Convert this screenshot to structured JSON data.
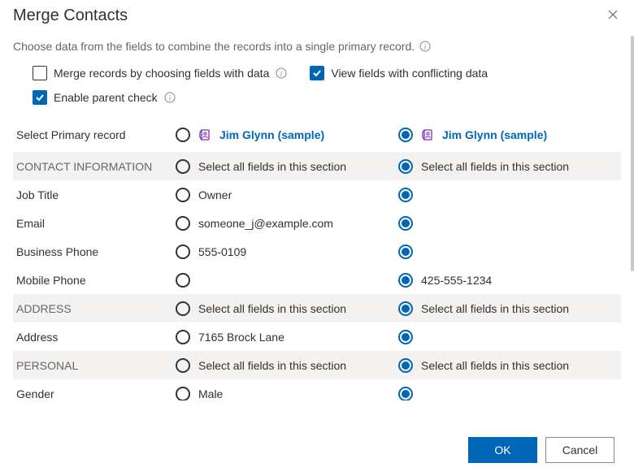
{
  "title": "Merge Contacts",
  "description": "Choose data from the fields to combine the records into a single primary record.",
  "options": {
    "merge_by_fields": {
      "label": "Merge records by choosing fields with data",
      "checked": false
    },
    "conflicting": {
      "label": "View fields with conflicting data",
      "checked": true
    },
    "parent_check": {
      "label": "Enable parent check",
      "checked": true
    }
  },
  "select_primary_label": "Select Primary record",
  "record_a": "Jim Glynn (sample)",
  "record_b": "Jim Glynn (sample)",
  "selected_primary": "b",
  "section_select_all_label": "Select all fields in this section",
  "sections": [
    {
      "header": "CONTACT INFORMATION",
      "fields": [
        {
          "label": "Job Title",
          "a": "Owner",
          "b": "",
          "sel": "b"
        },
        {
          "label": "Email",
          "a": "someone_j@example.com",
          "b": "",
          "sel": "b"
        },
        {
          "label": "Business Phone",
          "a": "555-0109",
          "b": "",
          "sel": "b"
        },
        {
          "label": "Mobile Phone",
          "a": "",
          "b": "425-555-1234",
          "sel": "b"
        }
      ]
    },
    {
      "header": "ADDRESS",
      "fields": [
        {
          "label": "Address",
          "a": "7165 Brock Lane",
          "b": "",
          "sel": "b"
        }
      ]
    },
    {
      "header": "PERSONAL",
      "fields": [
        {
          "label": "Gender",
          "a": "Male",
          "b": "",
          "sel": "b"
        }
      ]
    }
  ],
  "footer": {
    "ok": "OK",
    "cancel": "Cancel"
  }
}
